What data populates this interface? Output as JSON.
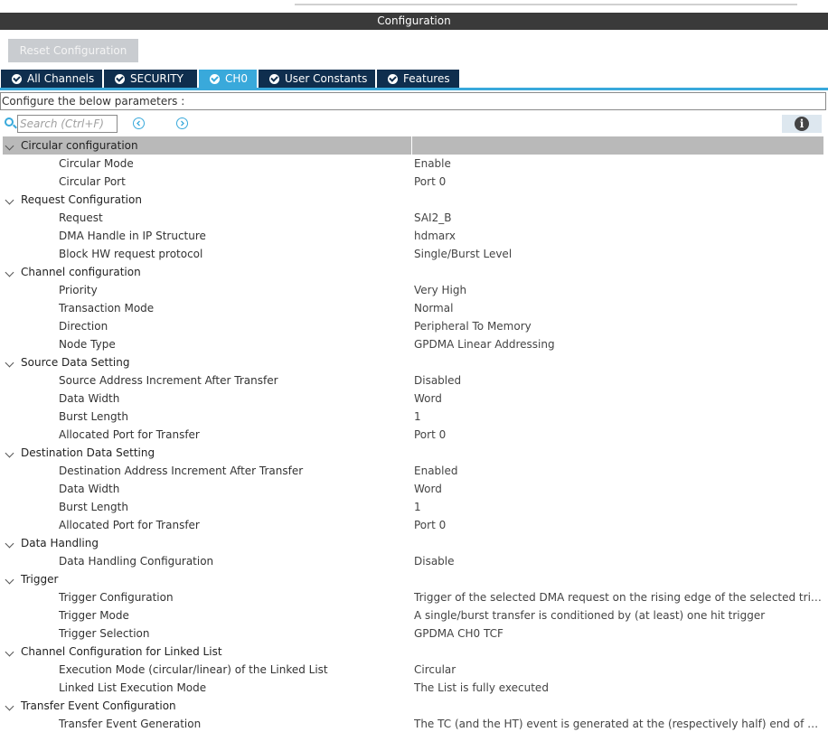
{
  "window": {
    "title": "Configuration"
  },
  "toolbar": {
    "reset_label": "Reset Configuration"
  },
  "tabs": [
    {
      "label": "All Channels",
      "active": false
    },
    {
      "label": "SECURITY",
      "active": false
    },
    {
      "label": "CH0",
      "active": true
    },
    {
      "label": "User Constants",
      "active": false
    },
    {
      "label": "Features",
      "active": false
    }
  ],
  "hint": "Configure the below parameters :",
  "search": {
    "placeholder": "Search (Ctrl+F)"
  },
  "colors": {
    "accent": "#39a9db",
    "tab_bg": "#0f2e4e",
    "title_bg": "#3a3a3a",
    "selected_row": "#b9b9b9"
  },
  "groups": [
    {
      "label": "Circular configuration",
      "params": [
        {
          "label": "Circular Mode",
          "value": "Enable"
        },
        {
          "label": "Circular Port",
          "value": "Port 0"
        }
      ]
    },
    {
      "label": "Request Configuration",
      "params": [
        {
          "label": "Request",
          "value": "SAI2_B"
        },
        {
          "label": "DMA Handle in IP Structure",
          "value": "hdmarx"
        },
        {
          "label": "Block HW request protocol",
          "value": "Single/Burst Level"
        }
      ]
    },
    {
      "label": "Channel configuration",
      "params": [
        {
          "label": "Priority",
          "value": "Very High"
        },
        {
          "label": "Transaction Mode",
          "value": "Normal"
        },
        {
          "label": "Direction",
          "value": "Peripheral To Memory"
        },
        {
          "label": "Node Type",
          "value": "GPDMA Linear Addressing"
        }
      ]
    },
    {
      "label": "Source Data Setting",
      "params": [
        {
          "label": "Source Address Increment After Transfer",
          "value": "Disabled"
        },
        {
          "label": "Data Width",
          "value": "Word"
        },
        {
          "label": "Burst Length",
          "value": "1"
        },
        {
          "label": "Allocated Port for Transfer",
          "value": "Port 0"
        }
      ]
    },
    {
      "label": "Destination Data Setting",
      "params": [
        {
          "label": "Destination Address Increment After Transfer",
          "value": "Enabled"
        },
        {
          "label": "Data Width",
          "value": "Word"
        },
        {
          "label": "Burst Length",
          "value": "1"
        },
        {
          "label": "Allocated Port for Transfer",
          "value": "Port 0"
        }
      ]
    },
    {
      "label": "Data Handling",
      "params": [
        {
          "label": "Data Handling Configuration",
          "value": "Disable"
        }
      ]
    },
    {
      "label": "Trigger",
      "params": [
        {
          "label": "Trigger Configuration",
          "value": "Trigger of the selected DMA request on the rising edge of the selected trigg..."
        },
        {
          "label": "Trigger Mode",
          "value": "A single/burst transfer is conditioned by (at least) one hit trigger"
        },
        {
          "label": "Trigger Selection",
          "value": "GPDMA CH0 TCF"
        }
      ]
    },
    {
      "label": "Channel Configuration for Linked List",
      "params": [
        {
          "label": "Execution Mode (circular/linear) of the Linked List",
          "value": "Circular"
        },
        {
          "label": "Linked List Execution Mode",
          "value": "The List is fully executed"
        }
      ]
    },
    {
      "label": "Transfer Event Configuration",
      "params": [
        {
          "label": "Transfer Event Generation",
          "value": "The TC (and the HT) event is generated at the (respectively half) end of each..."
        }
      ]
    }
  ]
}
